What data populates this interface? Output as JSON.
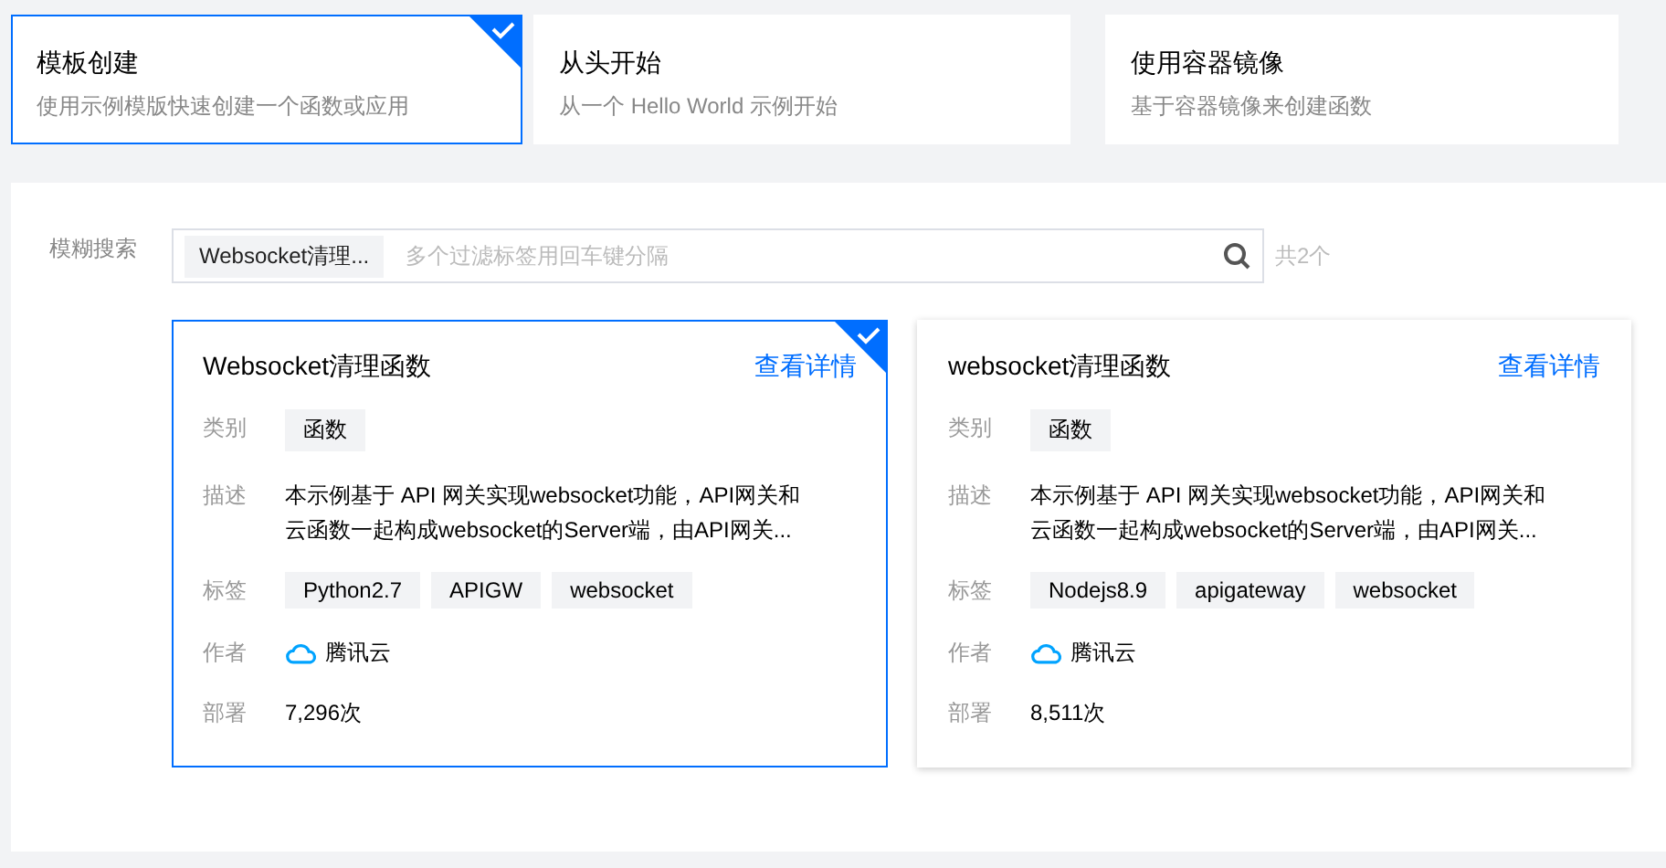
{
  "modes": [
    {
      "title": "模板创建",
      "subtitle": "使用示例模版快速创建一个函数或应用",
      "selected": true
    },
    {
      "title": "从头开始",
      "subtitle": "从一个 Hello World 示例开始",
      "selected": false
    },
    {
      "title": "使用容器镜像",
      "subtitle": "基于容器镜像来创建函数",
      "selected": false
    }
  ],
  "search": {
    "label": "模糊搜索",
    "chip": "Websocket清理...",
    "placeholder": "多个过滤标签用回车键分隔",
    "count": "共2个"
  },
  "templates": [
    {
      "title": "Websocket清理函数",
      "link": "查看详情",
      "selected": true,
      "fields": [
        {
          "kind": "tags",
          "label": "类别",
          "tags": [
            "函数"
          ]
        },
        {
          "kind": "text",
          "label": "描述",
          "lines": [
            "本示例基于 API 网关实现websocket功能，API网关和",
            "云函数一起构成websocket的Server端，由API网关..."
          ]
        },
        {
          "kind": "tags",
          "label": "标签",
          "tags": [
            "Python2.7",
            "APIGW",
            "websocket"
          ]
        },
        {
          "kind": "author",
          "label": "作者",
          "value": "腾讯云"
        },
        {
          "kind": "text",
          "label": "部署",
          "lines": [
            "7,296次"
          ]
        }
      ]
    },
    {
      "title": "websocket清理函数",
      "link": "查看详情",
      "selected": false,
      "fields": [
        {
          "kind": "tags",
          "label": "类别",
          "tags": [
            "函数"
          ]
        },
        {
          "kind": "text",
          "label": "描述",
          "lines": [
            "本示例基于 API 网关实现websocket功能，API网关和",
            "云函数一起构成websocket的Server端，由API网关..."
          ]
        },
        {
          "kind": "tags",
          "label": "标签",
          "tags": [
            "Nodejs8.9",
            "apigateway",
            "websocket"
          ]
        },
        {
          "kind": "author",
          "label": "作者",
          "value": "腾讯云"
        },
        {
          "kind": "text",
          "label": "部署",
          "lines": [
            "8,511次"
          ]
        }
      ]
    }
  ]
}
